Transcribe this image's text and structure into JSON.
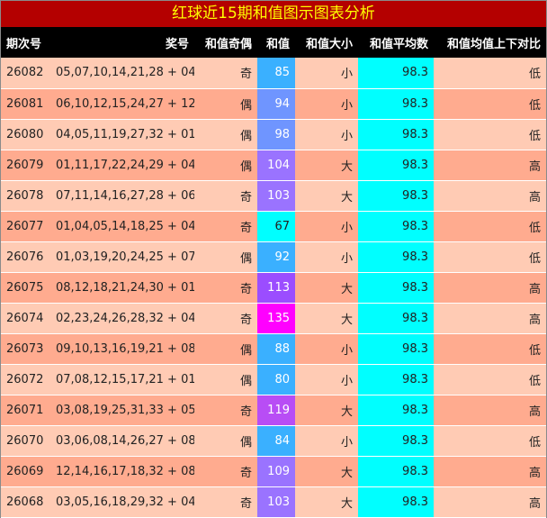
{
  "title": "红球近15期和值图示图表分析",
  "headers": [
    "期次号",
    "奖号",
    "和值奇偶",
    "和值",
    "和值大小",
    "和值平均数",
    "和值均值上下对比"
  ],
  "colors": {
    "title_bg": "#b40000",
    "title_text": "#ffff00",
    "header_bg": "#000000",
    "row_light": "#ffcbb4",
    "row_dark": "#ffab8f",
    "avg_bg": "#00ffff",
    "sum_scale": {
      "67": "#00ffff",
      "80": "#3ab0ff",
      "84": "#3ab0ff",
      "85": "#3ab0ff",
      "88": "#3ab0ff",
      "92": "#3ab0ff",
      "94": "#6f95ff",
      "98": "#6f95ff",
      "103": "#9a73ff",
      "104": "#9a73ff",
      "109": "#9a73ff",
      "113": "#9b4dff",
      "119": "#b84df5",
      "135": "#ff00ff"
    }
  },
  "rows": [
    {
      "period": "26082",
      "numbers": "05,07,10,14,21,28 + 04",
      "parity": "奇",
      "sum": "85",
      "size": "小",
      "average": "98.3",
      "compare": "低"
    },
    {
      "period": "26081",
      "numbers": "06,10,12,15,24,27 + 12",
      "parity": "偶",
      "sum": "94",
      "size": "小",
      "average": "98.3",
      "compare": "低"
    },
    {
      "period": "26080",
      "numbers": "04,05,11,19,27,32 + 01",
      "parity": "偶",
      "sum": "98",
      "size": "小",
      "average": "98.3",
      "compare": "低"
    },
    {
      "period": "26079",
      "numbers": "01,11,17,22,24,29 + 04",
      "parity": "偶",
      "sum": "104",
      "size": "大",
      "average": "98.3",
      "compare": "高"
    },
    {
      "period": "26078",
      "numbers": "07,11,14,16,27,28 + 06",
      "parity": "奇",
      "sum": "103",
      "size": "大",
      "average": "98.3",
      "compare": "高"
    },
    {
      "period": "26077",
      "numbers": "01,04,05,14,18,25 + 04",
      "parity": "奇",
      "sum": "67",
      "size": "小",
      "average": "98.3",
      "compare": "低"
    },
    {
      "period": "26076",
      "numbers": "01,03,19,20,24,25 + 07",
      "parity": "偶",
      "sum": "92",
      "size": "小",
      "average": "98.3",
      "compare": "低"
    },
    {
      "period": "26075",
      "numbers": "08,12,18,21,24,30 + 01",
      "parity": "奇",
      "sum": "113",
      "size": "大",
      "average": "98.3",
      "compare": "高"
    },
    {
      "period": "26074",
      "numbers": "02,23,24,26,28,32 + 04",
      "parity": "奇",
      "sum": "135",
      "size": "大",
      "average": "98.3",
      "compare": "高"
    },
    {
      "period": "26073",
      "numbers": "09,10,13,16,19,21 + 08",
      "parity": "偶",
      "sum": "88",
      "size": "小",
      "average": "98.3",
      "compare": "低"
    },
    {
      "period": "26072",
      "numbers": "07,08,12,15,17,21 + 01",
      "parity": "偶",
      "sum": "80",
      "size": "小",
      "average": "98.3",
      "compare": "低"
    },
    {
      "period": "26071",
      "numbers": "03,08,19,25,31,33 + 05",
      "parity": "奇",
      "sum": "119",
      "size": "大",
      "average": "98.3",
      "compare": "高"
    },
    {
      "period": "26070",
      "numbers": "03,06,08,14,26,27 + 08",
      "parity": "偶",
      "sum": "84",
      "size": "小",
      "average": "98.3",
      "compare": "低"
    },
    {
      "period": "26069",
      "numbers": "12,14,16,17,18,32 + 08",
      "parity": "奇",
      "sum": "109",
      "size": "大",
      "average": "98.3",
      "compare": "高"
    },
    {
      "period": "26068",
      "numbers": "03,05,16,18,29,32 + 04",
      "parity": "奇",
      "sum": "103",
      "size": "大",
      "average": "98.3",
      "compare": "高"
    }
  ]
}
